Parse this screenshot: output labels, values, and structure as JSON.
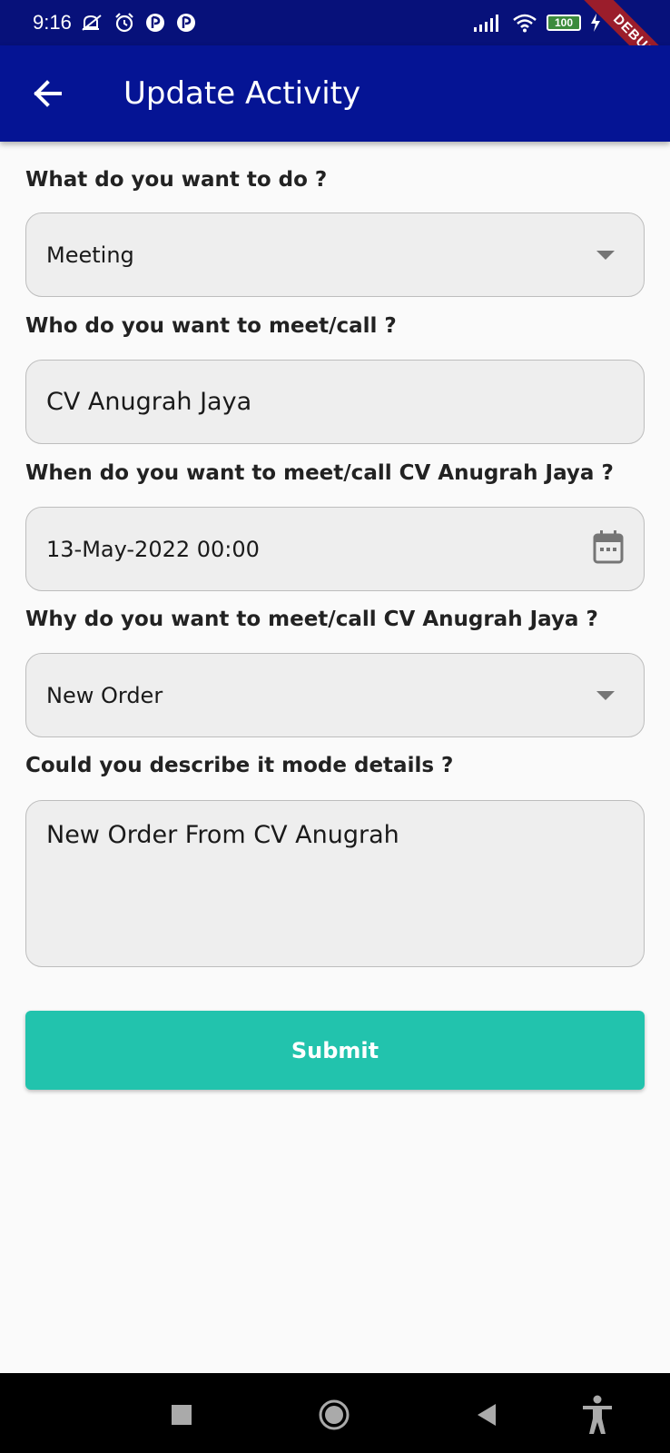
{
  "status_bar": {
    "time": "9:16",
    "battery": "100",
    "icons": [
      "mute-icon",
      "alarm-icon",
      "app-icon",
      "app-icon",
      "signal-icon",
      "wifi-icon",
      "battery-icon",
      "charging-icon"
    ]
  },
  "debug_banner": "DEBUG",
  "app_bar": {
    "title": "Update Activity",
    "back_icon": "arrow-left-icon"
  },
  "form": {
    "activity_type": {
      "label": "What do you want to do ?",
      "value": "Meeting"
    },
    "contact": {
      "label": "Who do you want to meet/call ?",
      "value": "CV Anugrah Jaya"
    },
    "datetime": {
      "label": "When do you want to meet/call CV Anugrah Jaya ?",
      "value": "13-May-2022 00:00",
      "icon": "calendar-icon"
    },
    "reason": {
      "label": "Why do you want to meet/call CV Anugrah Jaya ?",
      "value": "New Order"
    },
    "details": {
      "label": "Could you describe it mode details ?",
      "value": "New Order From CV Anugrah"
    },
    "submit_label": "Submit"
  },
  "colors": {
    "status_bar": "#07117a",
    "app_bar": "#051494",
    "submit": "#22c3ad",
    "field_bg": "#eeeeee",
    "nav_bar": "#000000"
  },
  "nav_bar": {
    "icons": [
      "recent-apps-icon",
      "home-icon",
      "back-icon",
      "accessibility-icon"
    ]
  }
}
